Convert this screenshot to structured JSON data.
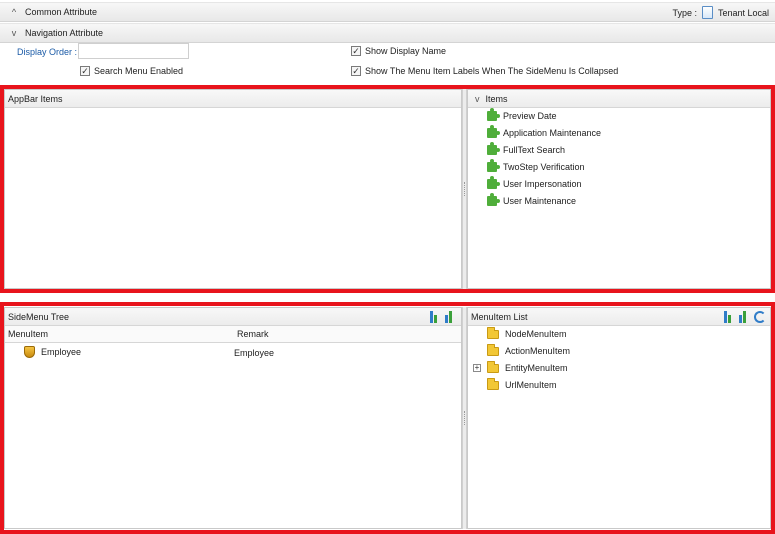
{
  "common": {
    "title": "Common Attribute",
    "type_label": "Type :",
    "type_value": "Tenant Local",
    "chevron": "^"
  },
  "navigation": {
    "title": "Navigation Attribute",
    "chevron": "v",
    "display_order_label": "Display Order :",
    "display_order_value": "",
    "show_display_name": {
      "label": "Show Display Name",
      "checked": true
    },
    "search_menu_enabled": {
      "label": "Search Menu Enabled",
      "checked": true
    },
    "show_labels_collapsed": {
      "label": "Show The Menu Item Labels When The SideMenu Is Collapsed",
      "checked": true
    }
  },
  "appbar": {
    "title": "AppBar Items"
  },
  "items": {
    "title": "Items",
    "chevron": "v",
    "list": [
      "Preview Date",
      "Application Maintenance",
      "FullText Search",
      "TwoStep Verification",
      "User Impersonation",
      "User Maintenance"
    ]
  },
  "sidemenu": {
    "title": "SideMenu Tree",
    "columns": [
      "MenuItem",
      "Remark"
    ],
    "rows": [
      {
        "menuitem": "Employee",
        "remark": "Employee"
      }
    ]
  },
  "menuitem_list": {
    "title": "MenuItem List",
    "items": [
      "NodeMenuItem",
      "ActionMenuItem",
      "EntityMenuItem",
      "UrlMenuItem"
    ],
    "expander": "+"
  },
  "colors": {
    "highlight": "#e8141c",
    "link_label": "#1a5aa6",
    "icon_green": "#4fae3a",
    "folder": "#f2c735"
  }
}
